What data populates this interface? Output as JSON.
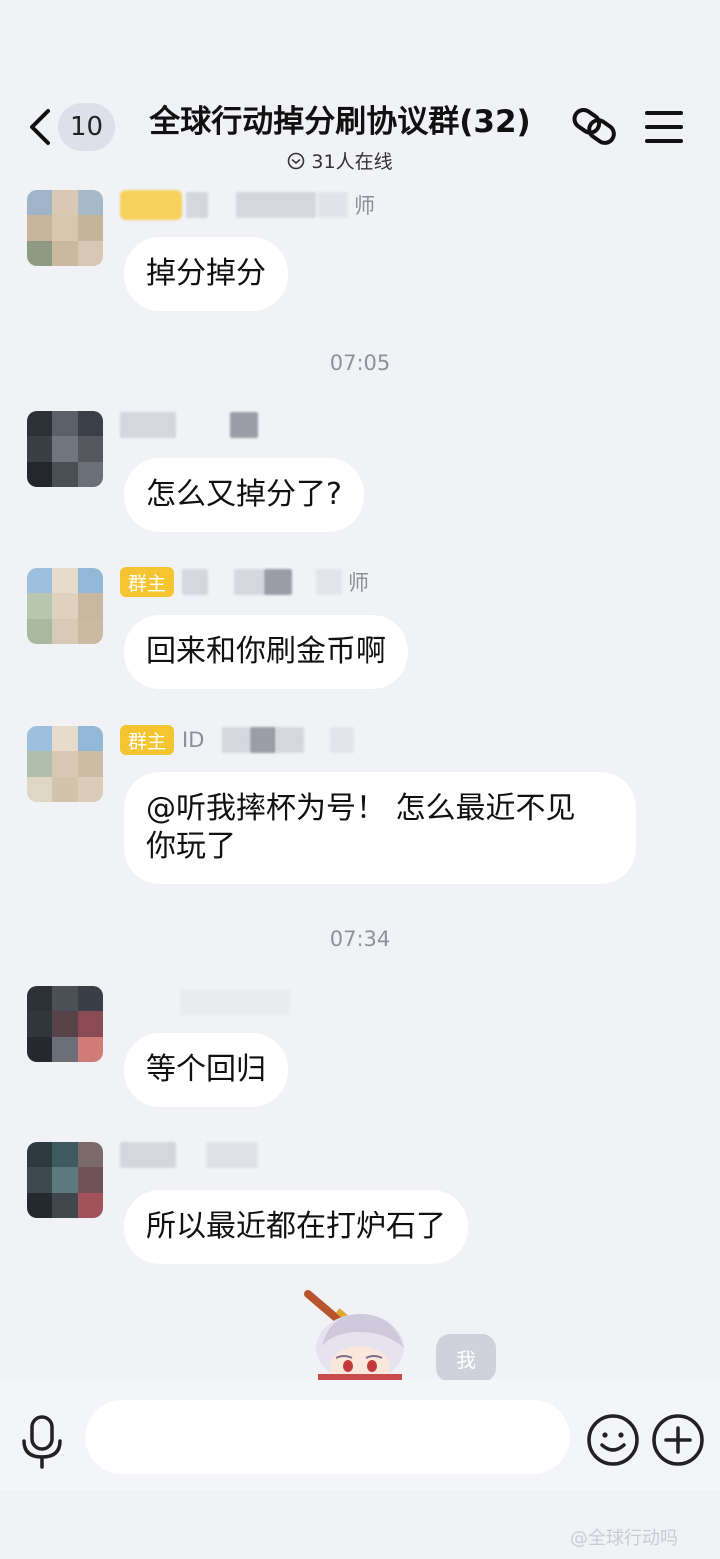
{
  "header": {
    "back_count": "10",
    "title": "全球行动掉分刷协议群(32)",
    "online_status": "31人在线"
  },
  "messages": [
    {
      "nick_suffix": "师",
      "text": "掉分掉分"
    },
    {
      "nick_suffix": "",
      "text": "怎么又掉分了?"
    },
    {
      "role": "群主",
      "nick_suffix": "师",
      "text": "回来和你刷金币啊"
    },
    {
      "role": "群主",
      "nick_prefix": "ID",
      "text_line1": "@听我摔杯为号！ 怎么最近不见",
      "text_line2": "你玩了"
    },
    {
      "nick_suffix": "",
      "text": "等个回归"
    },
    {
      "nick_suffix": "",
      "text": "所以最近都在打炉石了"
    }
  ],
  "timestamps": [
    "07:05",
    "07:34"
  ],
  "sticker": {
    "me_label": "我"
  },
  "input_bar": {
    "placeholder": ""
  },
  "watermark": "@全球行动吗",
  "colors": {
    "background": "#f1f2f6",
    "bubble": "#ffffff",
    "role_tag": "#f5c531",
    "timestamp": "#8e929b"
  },
  "icons": [
    "back-chevron-icon",
    "online-check-icon",
    "link-icon",
    "menu-icon",
    "mic-icon",
    "emoji-icon",
    "plus-icon"
  ]
}
